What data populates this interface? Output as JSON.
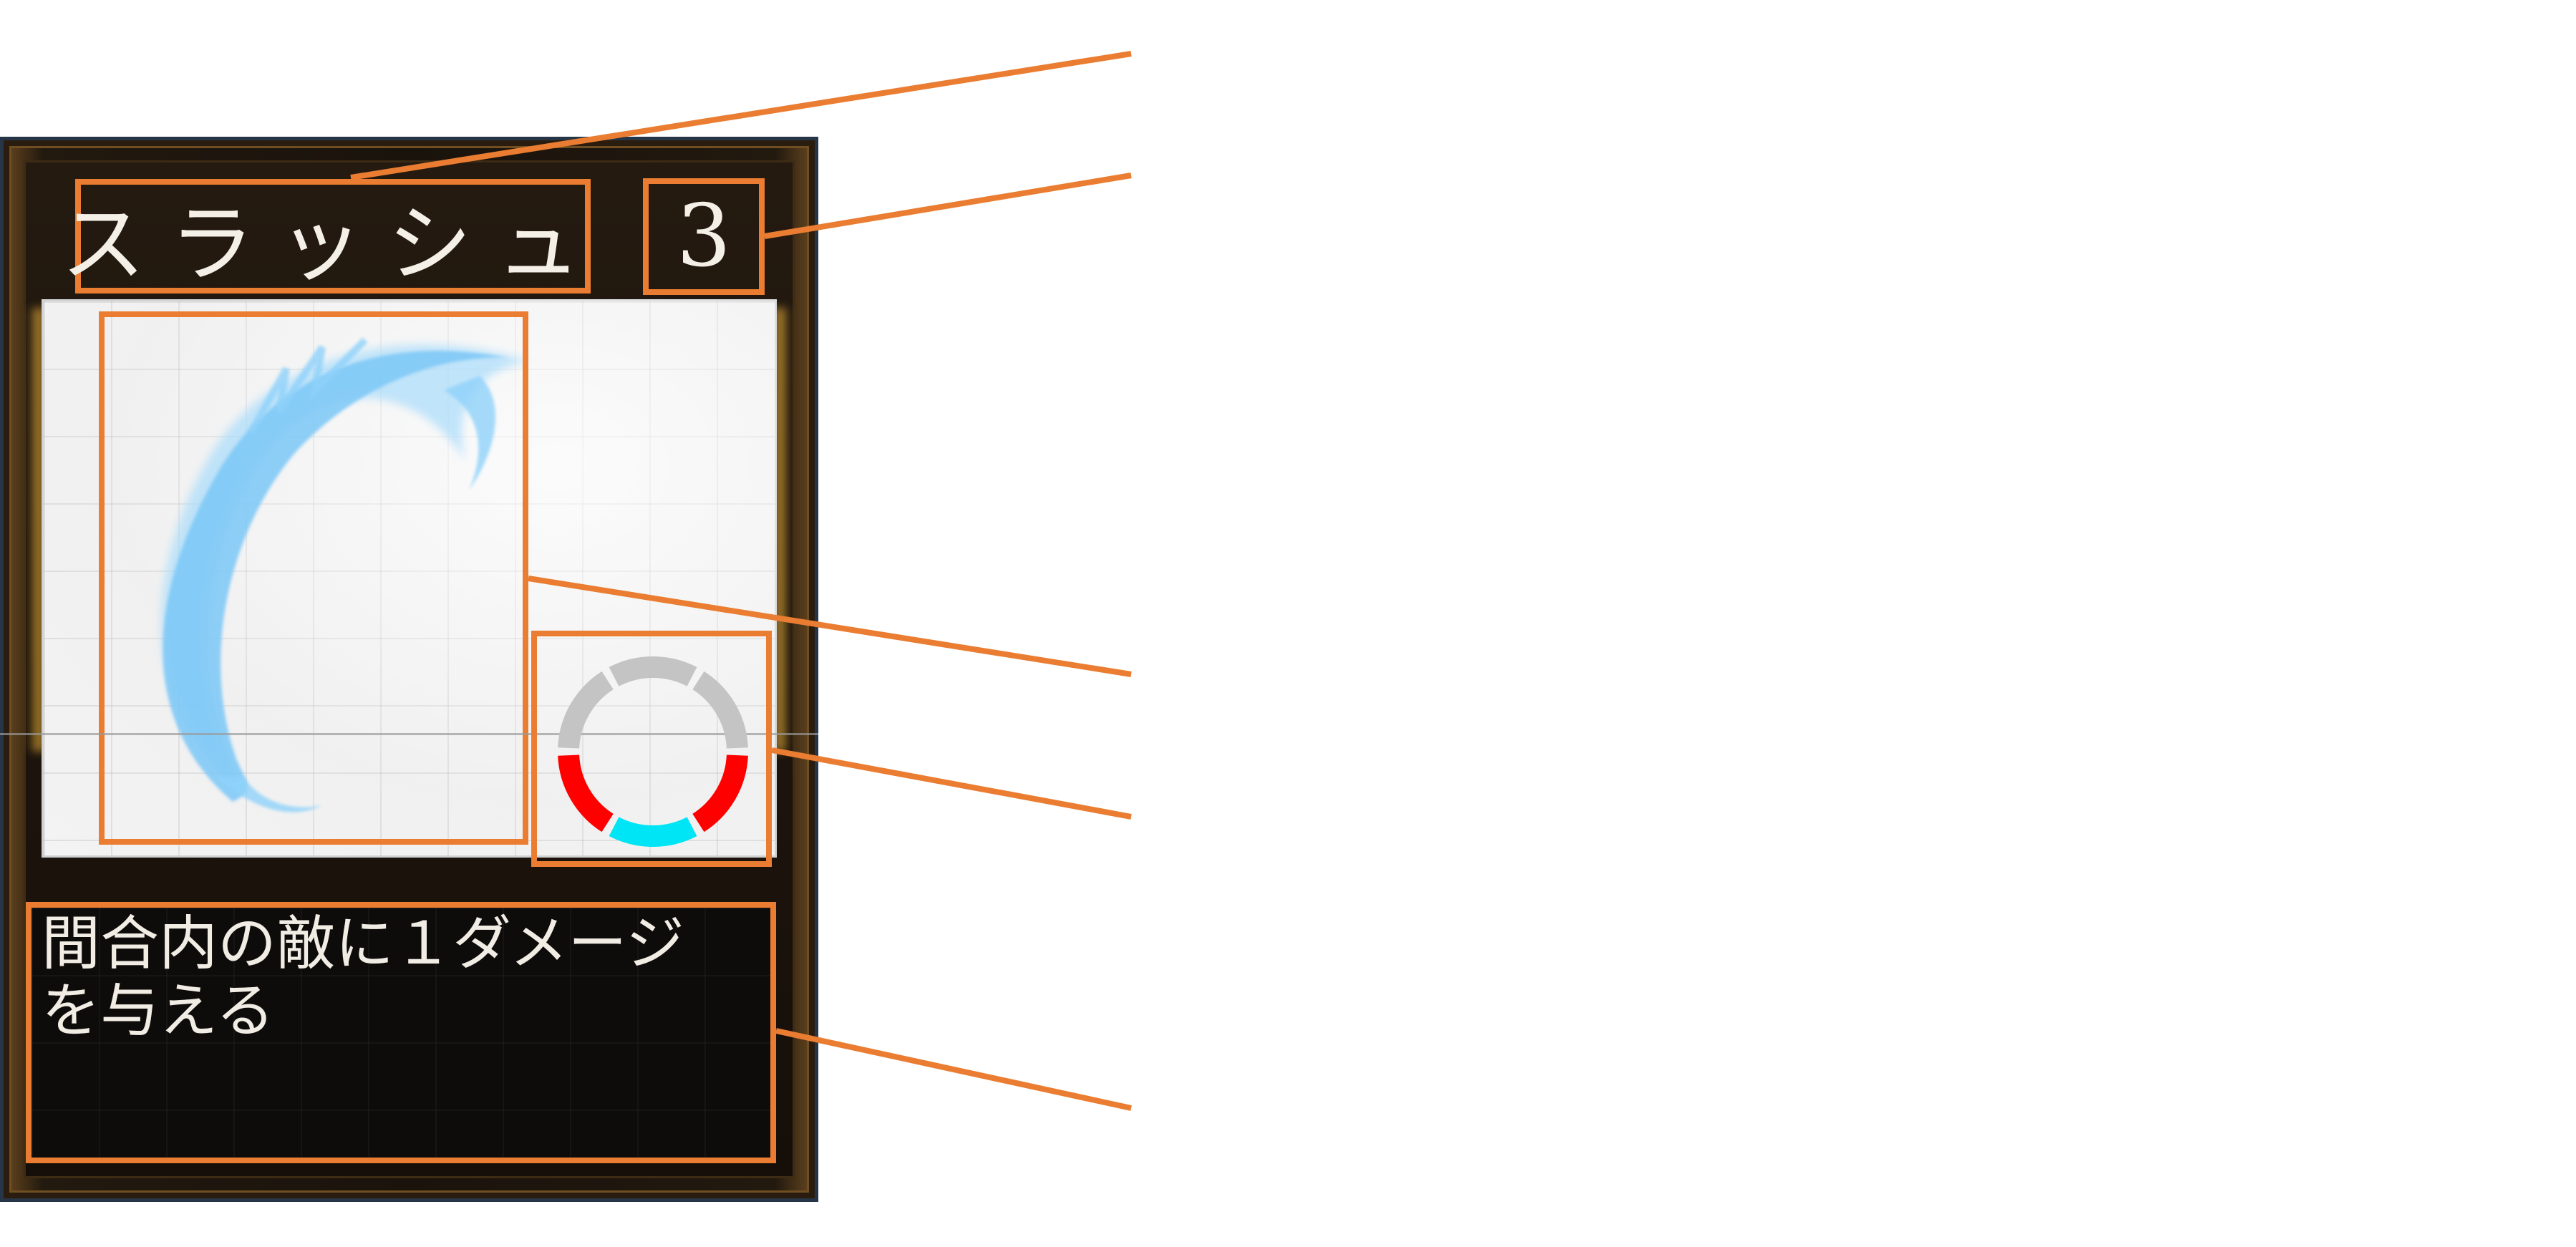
{
  "card": {
    "name": "スラッシュ",
    "cost": "3",
    "description": "間合内の敵に１ダメージ\nを与える"
  },
  "icons": {
    "art": "slash-effect-icon",
    "range": "range-ring-icon"
  },
  "range_ring": {
    "segments": [
      {
        "position": "top-left",
        "state": "inactive",
        "color": "#c4c4c4"
      },
      {
        "position": "top",
        "state": "inactive",
        "color": "#c4c4c4"
      },
      {
        "position": "top-right",
        "state": "inactive",
        "color": "#c4c4c4"
      },
      {
        "position": "right",
        "state": "attack",
        "color": "#ff0000"
      },
      {
        "position": "bottom",
        "state": "self",
        "color": "#00e5f5"
      },
      {
        "position": "left",
        "state": "attack",
        "color": "#ff0000"
      }
    ]
  },
  "colors": {
    "callout": "#ea7d31",
    "frame": "#1a140d",
    "frame_border": "#263646",
    "slash": "#6fc4f5"
  }
}
